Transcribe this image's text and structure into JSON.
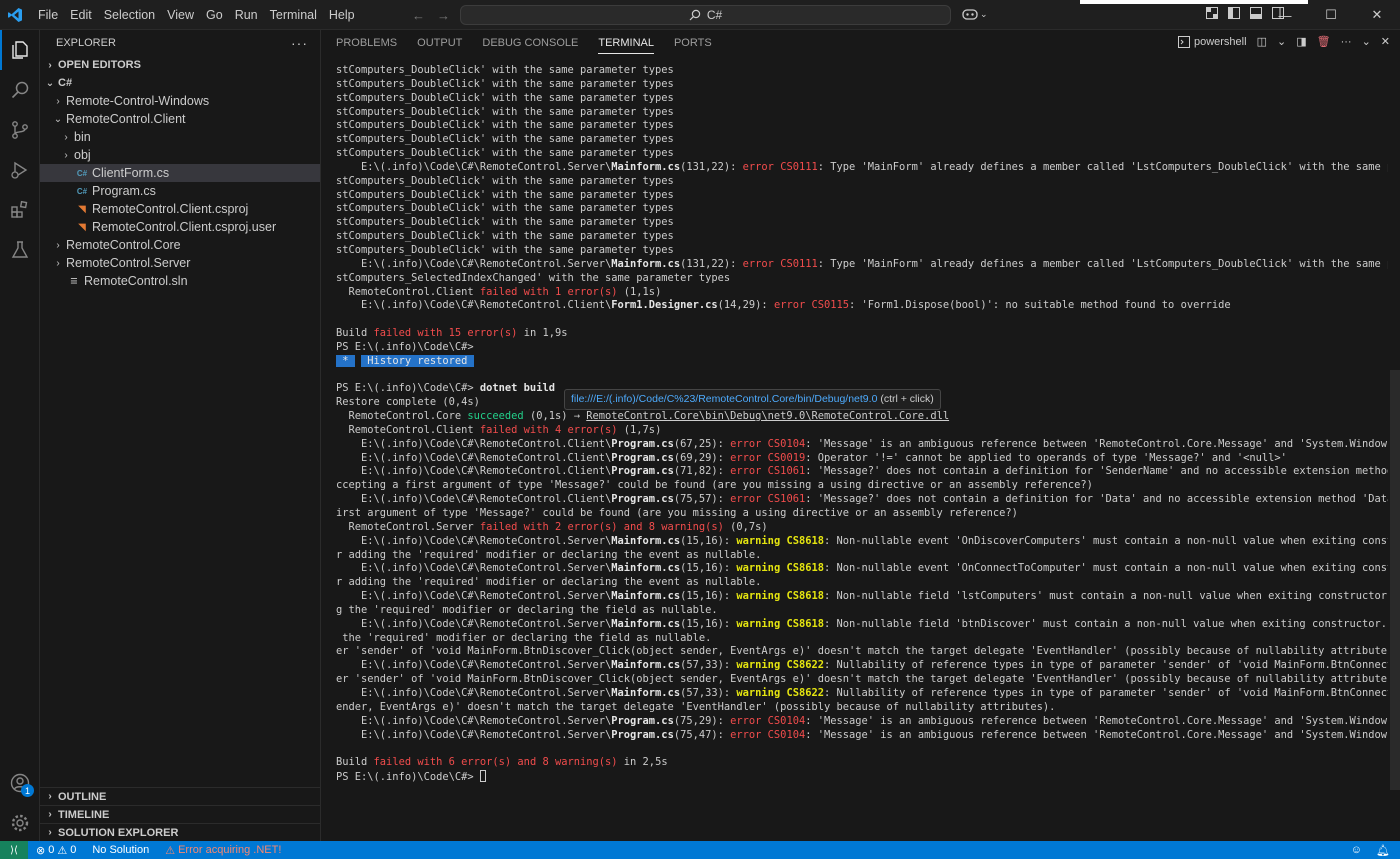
{
  "titlebar": {
    "menus": [
      "File",
      "Edit",
      "Selection",
      "View",
      "Go",
      "Run",
      "Terminal",
      "Help"
    ],
    "search_text": "C#"
  },
  "sidebar": {
    "title": "EXPLORER",
    "open_editors": "OPEN EDITORS",
    "root": "C#",
    "tree": [
      {
        "label": "Remote-Control-Windows",
        "indent": 1,
        "type": "folder",
        "expanded": false
      },
      {
        "label": "RemoteControl.Client",
        "indent": 1,
        "type": "folder",
        "expanded": true
      },
      {
        "label": "bin",
        "indent": 2,
        "type": "folder",
        "expanded": false
      },
      {
        "label": "obj",
        "indent": 2,
        "type": "folder",
        "expanded": false
      },
      {
        "label": "ClientForm.cs",
        "indent": 2,
        "type": "cs",
        "selected": true
      },
      {
        "label": "Program.cs",
        "indent": 2,
        "type": "cs"
      },
      {
        "label": "RemoteControl.Client.csproj",
        "indent": 2,
        "type": "rss"
      },
      {
        "label": "RemoteControl.Client.csproj.user",
        "indent": 2,
        "type": "rss"
      },
      {
        "label": "RemoteControl.Core",
        "indent": 1,
        "type": "folder",
        "expanded": false
      },
      {
        "label": "RemoteControl.Server",
        "indent": 1,
        "type": "folder",
        "expanded": false
      },
      {
        "label": "RemoteControl.sln",
        "indent": 1,
        "type": "sln"
      }
    ],
    "outline": "OUTLINE",
    "timeline": "TIMELINE",
    "solution_explorer": "SOLUTION EXPLORER"
  },
  "panel": {
    "tabs": [
      "PROBLEMS",
      "OUTPUT",
      "DEBUG CONSOLE",
      "TERMINAL",
      "PORTS"
    ],
    "active_tab": "TERMINAL",
    "shell": "powershell"
  },
  "terminal": {
    "lines": [
      [
        {
          "t": "stComputers_DoubleClick' with the same parameter types"
        }
      ],
      [
        {
          "t": "stComputers_DoubleClick' with the same parameter types"
        }
      ],
      [
        {
          "t": "stComputers_DoubleClick' with the same parameter types"
        }
      ],
      [
        {
          "t": "stComputers_DoubleClick' with the same parameter types"
        }
      ],
      [
        {
          "t": "stComputers_DoubleClick' with the same parameter types"
        }
      ],
      [
        {
          "t": "stComputers_DoubleClick' with the same parameter types"
        }
      ],
      [
        {
          "t": "stComputers_DoubleClick' with the same parameter types"
        }
      ],
      [
        {
          "t": "    E:\\(.info)\\Code\\C#\\RemoteControl.Server\\"
        },
        {
          "t": "Mainform.cs",
          "c": "b"
        },
        {
          "t": "(131,22): "
        },
        {
          "t": "error CS0111",
          "c": "err"
        },
        {
          "t": ": Type 'MainForm' already defines a member called 'LstComputers_DoubleClick' with the same parameter types"
        }
      ],
      [
        {
          "t": "stComputers_DoubleClick' with the same parameter types"
        }
      ],
      [
        {
          "t": "stComputers_DoubleClick' with the same parameter types"
        }
      ],
      [
        {
          "t": "stComputers_DoubleClick' with the same parameter types"
        }
      ],
      [
        {
          "t": "stComputers_DoubleClick' with the same parameter types"
        }
      ],
      [
        {
          "t": "stComputers_DoubleClick' with the same parameter types"
        }
      ],
      [
        {
          "t": "stComputers_DoubleClick' with the same parameter types"
        }
      ],
      [
        {
          "t": "    E:\\(.info)\\Code\\C#\\RemoteControl.Server\\"
        },
        {
          "t": "Mainform.cs",
          "c": "b"
        },
        {
          "t": "(131,22): "
        },
        {
          "t": "error CS0111",
          "c": "err"
        },
        {
          "t": ": Type 'MainForm' already defines a member called 'LstComputers_DoubleClick' with the same parameter types"
        }
      ],
      [
        {
          "t": "stComputers_SelectedIndexChanged' with the same parameter types"
        }
      ],
      [
        {
          "t": "  RemoteControl.Client "
        },
        {
          "t": "failed with 1 error(s)",
          "c": "err"
        },
        {
          "t": " (1,1s)"
        }
      ],
      [
        {
          "t": "    E:\\(.info)\\Code\\C#\\RemoteControl.Client\\"
        },
        {
          "t": "Form1.Designer.cs",
          "c": "b"
        },
        {
          "t": "(14,29): "
        },
        {
          "t": "error CS0115",
          "c": "err"
        },
        {
          "t": ": 'Form1.Dispose(bool)': no suitable method found to override"
        }
      ],
      [
        {
          "t": ""
        }
      ],
      [
        {
          "t": "Build "
        },
        {
          "t": "failed with 15 error(s)",
          "c": "err"
        },
        {
          "t": " in 1,9s"
        }
      ],
      [
        {
          "t": "PS E:\\(.info)\\Code\\C#>"
        }
      ],
      [
        {
          "t": " * ",
          "c": "hl"
        },
        {
          "t": " "
        },
        {
          "t": " History restored ",
          "c": "hl"
        }
      ],
      [
        {
          "t": ""
        }
      ],
      [
        {
          "t": "PS E:\\(.info)\\Code\\C#> "
        },
        {
          "t": "dotnet build",
          "c": "b"
        }
      ],
      [
        {
          "t": "Restore complete (0,4s)"
        }
      ],
      [
        {
          "t": "  RemoteControl.Core "
        },
        {
          "t": "succeeded",
          "c": "ok"
        },
        {
          "t": " (0,1s) → "
        },
        {
          "t": "RemoteControl.Core\\bin\\Debug\\net9.0\\RemoteControl.Core.dll",
          "c": "lnk"
        }
      ],
      [
        {
          "t": "  RemoteControl.Client "
        },
        {
          "t": "failed with 4 error(s)",
          "c": "err"
        },
        {
          "t": " (1,7s)"
        }
      ],
      [
        {
          "t": "    E:\\(.info)\\Code\\C#\\RemoteControl.Client\\"
        },
        {
          "t": "Program.cs",
          "c": "b"
        },
        {
          "t": "(67,25): "
        },
        {
          "t": "error CS0104",
          "c": "err"
        },
        {
          "t": ": 'Message' is an ambiguous reference between 'RemoteControl.Core.Message' and 'System.Windows.Forms.Message'"
        }
      ],
      [
        {
          "t": "    E:\\(.info)\\Code\\C#\\RemoteControl.Client\\"
        },
        {
          "t": "Program.cs",
          "c": "b"
        },
        {
          "t": "(69,29): "
        },
        {
          "t": "error CS0019",
          "c": "err"
        },
        {
          "t": ": Operator '!=' cannot be applied to operands of type 'Message?' and '<null>'"
        }
      ],
      [
        {
          "t": "    E:\\(.info)\\Code\\C#\\RemoteControl.Client\\"
        },
        {
          "t": "Program.cs",
          "c": "b"
        },
        {
          "t": "(71,82): "
        },
        {
          "t": "error CS1061",
          "c": "err"
        },
        {
          "t": ": 'Message?' does not contain a definition for 'SenderName' and no accessible extension method 'SenderName' a"
        }
      ],
      [
        {
          "t": "ccepting a first argument of type 'Message?' could be found (are you missing a using directive or an assembly reference?)"
        }
      ],
      [
        {
          "t": "    E:\\(.info)\\Code\\C#\\RemoteControl.Client\\"
        },
        {
          "t": "Program.cs",
          "c": "b"
        },
        {
          "t": "(75,57): "
        },
        {
          "t": "error CS1061",
          "c": "err"
        },
        {
          "t": ": 'Message?' does not contain a definition for 'Data' and no accessible extension method 'Data' accepting a f"
        }
      ],
      [
        {
          "t": "irst argument of type 'Message?' could be found (are you missing a using directive or an assembly reference?)"
        }
      ],
      [
        {
          "t": "  RemoteControl.Server "
        },
        {
          "t": "failed with 2 error(s) and 8 warning(s)",
          "c": "err"
        },
        {
          "t": " (0,7s)"
        }
      ],
      [
        {
          "t": "    E:\\(.info)\\Code\\C#\\RemoteControl.Server\\"
        },
        {
          "t": "Mainform.cs",
          "c": "b"
        },
        {
          "t": "(15,16): "
        },
        {
          "t": "warning CS8618",
          "c": "warn"
        },
        {
          "t": ": Non-nullable event 'OnDiscoverComputers' must contain a non-null value when exiting constructor. Conside"
        }
      ],
      [
        {
          "t": "r adding the 'required' modifier or declaring the event as nullable."
        }
      ],
      [
        {
          "t": "    E:\\(.info)\\Code\\C#\\RemoteControl.Server\\"
        },
        {
          "t": "Mainform.cs",
          "c": "b"
        },
        {
          "t": "(15,16): "
        },
        {
          "t": "warning CS8618",
          "c": "warn"
        },
        {
          "t": ": Non-nullable event 'OnConnectToComputer' must contain a non-null value when exiting constructor. Conside"
        }
      ],
      [
        {
          "t": "r adding the 'required' modifier or declaring the event as nullable."
        }
      ],
      [
        {
          "t": "    E:\\(.info)\\Code\\C#\\RemoteControl.Server\\"
        },
        {
          "t": "Mainform.cs",
          "c": "b"
        },
        {
          "t": "(15,16): "
        },
        {
          "t": "warning CS8618",
          "c": "warn"
        },
        {
          "t": ": Non-nullable field 'lstComputers' must contain a non-null value when exiting constructor. Consider addin"
        }
      ],
      [
        {
          "t": "g the 'required' modifier or declaring the field as nullable."
        }
      ],
      [
        {
          "t": "    E:\\(.info)\\Code\\C#\\RemoteControl.Server\\"
        },
        {
          "t": "Mainform.cs",
          "c": "b"
        },
        {
          "t": "(15,16): "
        },
        {
          "t": "warning CS8618",
          "c": "warn"
        },
        {
          "t": ": Non-nullable field 'btnDiscover' must contain a non-null value when exiting constructor. Consider adding"
        }
      ],
      [
        {
          "t": " the 'required' modifier or declaring the field as nullable."
        }
      ],
      [
        {
          "t": "er 'sender' of 'void MainForm.BtnDiscover_Click(object sender, EventArgs e)' doesn't match the target delegate 'EventHandler' (possibly because of nullability attributes)."
        }
      ],
      [
        {
          "t": "    E:\\(.info)\\Code\\C#\\RemoteControl.Server\\"
        },
        {
          "t": "Mainform.cs",
          "c": "b"
        },
        {
          "t": "(57,33): "
        },
        {
          "t": "warning CS8622",
          "c": "warn"
        },
        {
          "t": ": Nullability of reference types in type of parameter 'sender' of 'void MainForm.BtnConnect_Click(object s"
        }
      ],
      [
        {
          "t": "er 'sender' of 'void MainForm.BtnDiscover_Click(object sender, EventArgs e)' doesn't match the target delegate 'EventHandler' (possibly because of nullability attributes)."
        }
      ],
      [
        {
          "t": "    E:\\(.info)\\Code\\C#\\RemoteControl.Server\\"
        },
        {
          "t": "Mainform.cs",
          "c": "b"
        },
        {
          "t": "(57,33): "
        },
        {
          "t": "warning CS8622",
          "c": "warn"
        },
        {
          "t": ": Nullability of reference types in type of parameter 'sender' of 'void MainForm.BtnConnect_Click(object s"
        }
      ],
      [
        {
          "t": "ender, EventArgs e)' doesn't match the target delegate 'EventHandler' (possibly because of nullability attributes)."
        }
      ],
      [
        {
          "t": "    E:\\(.info)\\Code\\C#\\RemoteControl.Server\\"
        },
        {
          "t": "Program.cs",
          "c": "b"
        },
        {
          "t": "(75,29): "
        },
        {
          "t": "error CS0104",
          "c": "err"
        },
        {
          "t": ": 'Message' is an ambiguous reference between 'RemoteControl.Core.Message' and 'System.Windows.Forms.Message'"
        }
      ],
      [
        {
          "t": "    E:\\(.info)\\Code\\C#\\RemoteControl.Server\\"
        },
        {
          "t": "Program.cs",
          "c": "b"
        },
        {
          "t": "(75,47): "
        },
        {
          "t": "error CS0104",
          "c": "err"
        },
        {
          "t": ": 'Message' is an ambiguous reference between 'RemoteControl.Core.Message' and 'System.Windows.Forms.Message'"
        }
      ],
      [
        {
          "t": ""
        }
      ],
      [
        {
          "t": "Build "
        },
        {
          "t": "failed with 6 error(s) and 8 warning(s)",
          "c": "err"
        },
        {
          "t": " in 2,5s"
        }
      ],
      [
        {
          "t": "PS E:\\(.info)\\Code\\C#> "
        },
        {
          "t": "",
          "c": "cursor"
        }
      ]
    ],
    "hover_tip": {
      "link": "file:///E:/(.info)/Code/C%23/RemoteControl.Core/bin/Debug/net9.0",
      "hint": " (ctrl + click)"
    }
  },
  "statusbar": {
    "errors": "0",
    "warnings": "0",
    "solution": "No Solution",
    "build_msg": "Error acquiring .NET!"
  },
  "colors": {
    "accent": "#0078d4",
    "error": "#f14c4c",
    "warning": "#e5e510",
    "success": "#23d18b"
  }
}
